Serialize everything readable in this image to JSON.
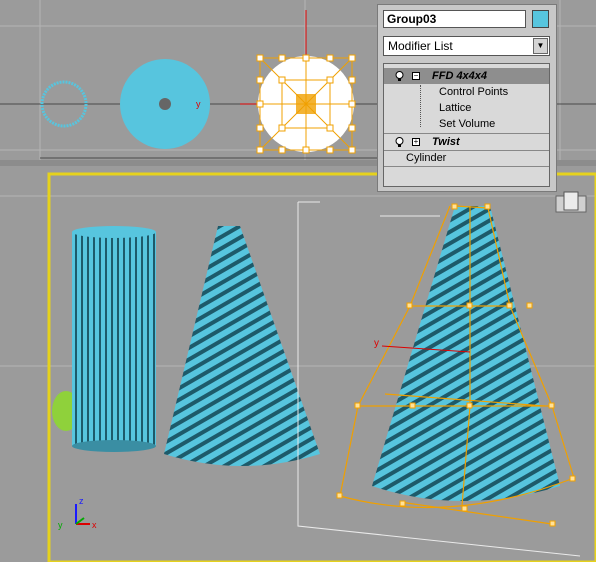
{
  "panel": {
    "object_name": "Group03",
    "object_color": "#57c5de",
    "modifier_list_label": "Modifier List",
    "stack": {
      "ffd_label": "FFD 4x4x4",
      "sub_items": [
        "Control Points",
        "Lattice",
        "Set Volume"
      ],
      "twist_label": "Twist",
      "base_label": "Cylinder"
    }
  },
  "axis": {
    "x_label": "x",
    "y_label": "y",
    "z_label": "z"
  },
  "colors": {
    "viewport_bg": "#9b9b9b",
    "object_cyan": "#57c5de",
    "lattice_orange": "#f0a000",
    "active_border": "#e6d21c",
    "grid_line": "#b4b4b4"
  }
}
